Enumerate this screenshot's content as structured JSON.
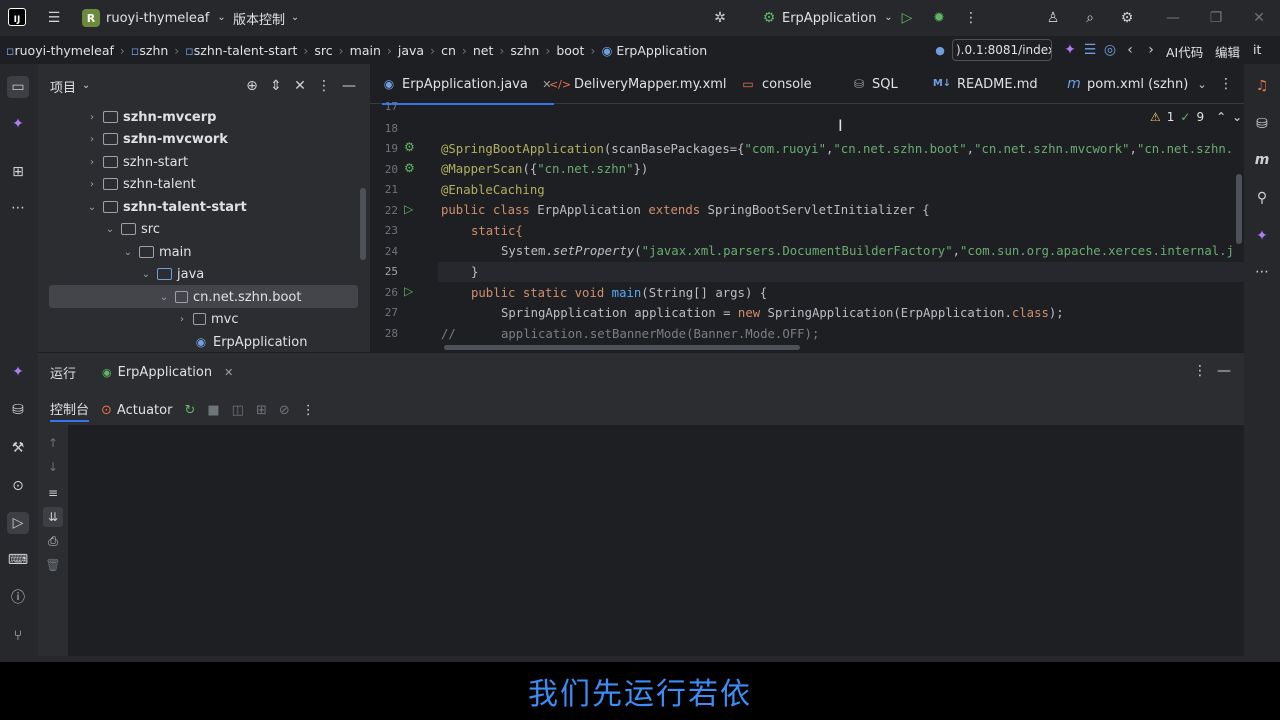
{
  "topbar": {
    "logo": "IJ",
    "project_badge": "R",
    "project_name": "ruoyi-thymeleaf",
    "vcs_label": "版本控制",
    "run_config": "ErpApplication",
    "icons": [
      "hamburger-icon",
      "bug-icon",
      "run-icon",
      "debug-icon",
      "more-icon",
      "add-user-icon",
      "search-icon",
      "settings-icon",
      "minimize-icon",
      "maximize-icon",
      "close-icon"
    ]
  },
  "breadcrumb": {
    "items": [
      "ruoyi-thymeleaf",
      "szhn",
      "szhn-talent-start",
      "src",
      "main",
      "java",
      "cn",
      "net",
      "szhn",
      "boot",
      "ErpApplication"
    ],
    "url": ").0.1:8081/index",
    "ai_label": "AI代码",
    "edit_label": "编辑",
    "quit_label": "it"
  },
  "project_panel": {
    "title": "项目",
    "tree": [
      {
        "label": "szhn-mvcerp",
        "bold": true
      },
      {
        "label": "szhn-mvcwork",
        "bold": true
      },
      {
        "label": "szhn-start",
        "bold": false
      },
      {
        "label": "szhn-talent",
        "bold": false
      },
      {
        "label": "szhn-talent-start",
        "bold": true
      },
      {
        "label": "src",
        "bold": false
      },
      {
        "label": "main",
        "bold": false
      },
      {
        "label": "java",
        "bold": false
      },
      {
        "label": "cn.net.szhn.boot",
        "bold": false
      },
      {
        "label": "mvc",
        "bold": false
      },
      {
        "label": "ErpApplication",
        "bold": false
      }
    ]
  },
  "editor": {
    "tabs": [
      "ErpApplication.java",
      "DeliveryMapper.my.xml",
      "console",
      "SQL",
      "README.md",
      "pom.xml (szhn)"
    ],
    "inspection": {
      "warnings": "1",
      "checks": "9"
    },
    "line_numbers": [
      "17",
      "18",
      "19",
      "20",
      "21",
      "22",
      "23",
      "24",
      "25",
      "26",
      "27",
      "28"
    ],
    "code": {
      "l19_a": "@SpringBootApplication",
      "l19_b": "(scanBasePackages={",
      "l19_s1": "\"com.ruoyi\"",
      "l19_c": ",",
      "l19_s2": "\"cn.net.szhn.boot\"",
      "l19_s3": "\"cn.net.szhn.mvcwork\"",
      "l19_s4": "\"cn.net.szhn.",
      "l20_a": "@MapperScan",
      "l20_b": "({",
      "l20_s": "\"cn.net.szhn\"",
      "l20_c": "})",
      "l21": "@EnableCaching",
      "l22_kw": "public class ",
      "l22_name": "ErpApplication ",
      "l22_ext": "extends ",
      "l22_rest": "SpringBootServletInitializer {",
      "l23": "static{",
      "l24_a": "System.",
      "l24_b": "setProperty",
      "l24_c": "(",
      "l24_s1": "\"javax.xml.parsers.DocumentBuilderFactory\"",
      "l24_d": ",",
      "l24_s2": "\"com.sun.org.apache.xerces.internal.j",
      "l25": "}",
      "l26_kw": "public static void ",
      "l26_fn": "main",
      "l26_rest": "(String[] args) {",
      "l27_a": "SpringApplication application = ",
      "l27_kw": "new ",
      "l27_b": "SpringApplication(ErpApplication.",
      "l27_kw2": "class",
      "l27_c": ");",
      "l28_slash": "//",
      "l28_cmt": "application.setBannerMode(Banner.Mode.OFF);"
    }
  },
  "run_panel": {
    "title": "运行",
    "config_tab": "ErpApplication",
    "console_tab": "控制台",
    "actuator_tab": "Actuator"
  },
  "subtitle": "我们先运行若依",
  "colors": {
    "accent": "#3574f0",
    "subtitle": "#3a8ef6",
    "run_green": "#5fb865",
    "ai_purple": "#b07cf5"
  }
}
